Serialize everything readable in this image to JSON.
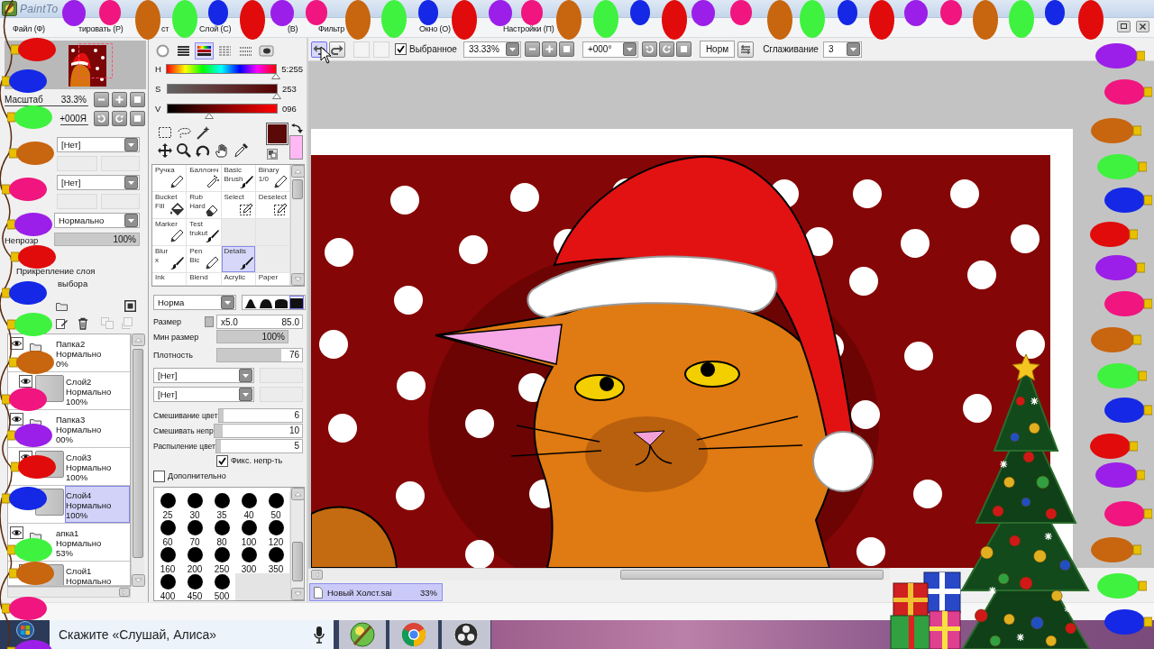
{
  "window": {
    "title": "PaintTo"
  },
  "menu": [
    {
      "label": "Файл (Ф)"
    },
    {
      "label": "тировать (Р)"
    },
    {
      "label": "ст"
    },
    {
      "label": "Слой (С)"
    },
    {
      "label": "(В)"
    },
    {
      "label": "Фильтр"
    },
    {
      "label": "Окно (О)"
    },
    {
      "label": "Настройки (П)"
    }
  ],
  "toolbar": {
    "history": [
      {
        "hovered": true
      },
      {
        "hovered": false
      }
    ],
    "selected_filter": {
      "label": "Выбранное",
      "checked": true
    },
    "zoom": "33.33%",
    "angle": "+000°",
    "flip": "Норм",
    "smoothing_label": "Сглаживание",
    "smoothing": "3"
  },
  "navigator": {
    "zoom_label": "Масштаб",
    "zoom": "33.3%",
    "angle": "+000Я"
  },
  "layer_props": {
    "texture": "[Нет]",
    "effect": "[Нет]",
    "blend": "Нормально",
    "opacity": {
      "label": "Непрозр",
      "value": "100%",
      "level": 1
    },
    "clipping": "Прикрепление слоя",
    "selection_source": "выбора"
  },
  "layers": [
    {
      "kind": "folder",
      "name": "Папка2",
      "mode": "Нормально",
      "opacity": "0%",
      "selected": false,
      "children": [
        {
          "kind": "layer",
          "name": "Слой2",
          "mode": "Нормально",
          "opacity": "100%",
          "selected": false
        }
      ]
    },
    {
      "kind": "folder",
      "name": "Папка3",
      "mode": "Нормально",
      "opacity": "00%",
      "selected": false,
      "children": [
        {
          "kind": "layer",
          "name": "Слой3",
          "mode": "Нормально",
          "opacity": "100%",
          "selected": false
        },
        {
          "kind": "layer",
          "name": "Слой4",
          "mode": "Нормально",
          "opacity": "100%",
          "selected": true
        }
      ]
    },
    {
      "kind": "folder",
      "name": "апка1",
      "mode": "Нормально",
      "opacity": "53%",
      "selected": false,
      "children": [
        {
          "kind": "layer",
          "name": "Слой1",
          "mode": "Нормально",
          "selected": false
        }
      ]
    }
  ],
  "colors": {
    "modes": [
      {
        "selected": false
      },
      {
        "selected": false
      },
      {
        "selected": true
      },
      {
        "selected": false
      },
      {
        "selected": false
      },
      {
        "selected": false
      }
    ],
    "sliders": [
      {
        "label": "H",
        "value": "5:255",
        "level": 0.99
      },
      {
        "label": "S",
        "value": "253",
        "level": 0.99
      },
      {
        "label": "V",
        "value": "096",
        "level": 0.38
      }
    ],
    "swatches": [
      {
        "color": "#5a0808"
      },
      {
        "color": "#ffb8f4"
      }
    ]
  },
  "tools": {
    "rows": [
      [
        {
          "label": "Ручка",
          "selected": false
        },
        {
          "label": "Баллонч",
          "selected": false
        },
        {
          "label": "Basic Brush",
          "selected": false
        },
        {
          "label": "Binary 1/0",
          "selected": false
        }
      ],
      [
        {
          "label": "Bucket Fill",
          "selected": false
        },
        {
          "label": "Rub Hard",
          "selected": false
        },
        {
          "label": "Select",
          "selected": false
        },
        {
          "label": "Deselect",
          "selected": false
        }
      ],
      [
        {
          "label": "Marker",
          "selected": false
        },
        {
          "label": "Test trukut",
          "selected": false
        }
      ],
      [
        {
          "label": "Blur x",
          "selected": false
        },
        {
          "label": "Pen Bic",
          "selected": false
        },
        {
          "label": "Details",
          "selected": true
        }
      ],
      [
        {
          "label": "Ink",
          "selected": false
        },
        {
          "label": "Blend",
          "selected": false
        },
        {
          "label": "Acrylic",
          "selected": false
        },
        {
          "label": "Paper",
          "selected": false
        }
      ]
    ]
  },
  "brush": {
    "shape": "Норма",
    "tips": [
      {
        "selected": false
      },
      {
        "selected": false
      },
      {
        "selected": false
      },
      {
        "selected": true
      }
    ],
    "size": {
      "label": "Размер",
      "multiplier": "x5.0",
      "value": "85.0"
    },
    "min_size": {
      "label": "Мин размер",
      "value": "100%",
      "level": 1
    },
    "density": {
      "label": "Плотность",
      "value": "76",
      "level": 0.76
    },
    "textures": [
      {
        "value": "[Нет]"
      },
      {
        "value": "[Нет]"
      }
    ],
    "mixing": [
      {
        "label": "Смешивание цвет",
        "value": "6",
        "level": 0.06
      },
      {
        "label": "Смешивать непр",
        "value": "10",
        "level": 0.1
      },
      {
        "label": "Распыление цвет",
        "value": "5",
        "level": 0.05
      }
    ],
    "checks": [
      {
        "label": "Фикс. непр-ть",
        "checked": true
      },
      {
        "label": "Дополнительно",
        "checked": false
      }
    ]
  },
  "brush_sizes": [
    "25",
    "30",
    "35",
    "40",
    "50",
    "60",
    "70",
    "80",
    "100",
    "120",
    "160",
    "200",
    "250",
    "300",
    "350",
    "400",
    "450",
    "500"
  ],
  "documents": [
    {
      "name": "Новый Холст.sai",
      "zoom": "33%",
      "selected": true
    }
  ],
  "taskbar": {
    "search": {
      "placeholder": "Скажите «Слушай, Алиса»"
    }
  },
  "lights": {
    "top": [
      {
        "color": "#9b1fe8"
      },
      {
        "color": "#f0157f"
      },
      {
        "color": "#c8650f"
      },
      {
        "color": "#3ff23f"
      },
      {
        "color": "#1428e6"
      },
      {
        "color": "#e10b0b"
      },
      {
        "color": "#9b1fe8"
      },
      {
        "color": "#f0157f"
      },
      {
        "color": "#c8650f"
      },
      {
        "color": "#3ff23f"
      },
      {
        "color": "#1428e6"
      },
      {
        "color": "#e10b0b"
      },
      {
        "color": "#9b1fe8"
      },
      {
        "color": "#f0157f"
      },
      {
        "color": "#c8650f"
      },
      {
        "color": "#3ff23f"
      },
      {
        "color": "#1428e6"
      },
      {
        "color": "#e10b0b"
      },
      {
        "color": "#9b1fe8"
      },
      {
        "color": "#f0157f"
      },
      {
        "color": "#c8650f"
      },
      {
        "color": "#3ff23f"
      },
      {
        "color": "#1428e6"
      },
      {
        "color": "#e10b0b"
      },
      {
        "color": "#9b1fe8"
      },
      {
        "color": "#f0157f"
      },
      {
        "color": "#c8650f"
      },
      {
        "color": "#3ff23f"
      },
      {
        "color": "#1428e6"
      },
      {
        "color": "#e10b0b"
      }
    ],
    "left": [
      {
        "color": "#e10b0b"
      },
      {
        "color": "#1428e6"
      },
      {
        "color": "#3ff23f"
      },
      {
        "color": "#c8650f"
      },
      {
        "color": "#f0157f"
      },
      {
        "color": "#9b1fe8"
      },
      {
        "color": "#e10b0b"
      },
      {
        "color": "#1428e6"
      },
      {
        "color": "#3ff23f"
      },
      {
        "color": "#c8650f"
      },
      {
        "color": "#f0157f"
      },
      {
        "color": "#9b1fe8"
      },
      {
        "color": "#e10b0b"
      },
      {
        "color": "#1428e6"
      },
      {
        "color": "#3ff23f"
      },
      {
        "color": "#c8650f"
      },
      {
        "color": "#f0157f"
      },
      {
        "color": "#9b1fe8"
      }
    ],
    "right": [
      {
        "color": "#9b1fe8"
      },
      {
        "color": "#f0157f"
      },
      {
        "color": "#c8650f"
      },
      {
        "color": "#3ff23f"
      },
      {
        "color": "#1428e6"
      },
      {
        "color": "#e10b0b"
      },
      {
        "color": "#9b1fe8"
      },
      {
        "color": "#f0157f"
      },
      {
        "color": "#c8650f"
      },
      {
        "color": "#3ff23f"
      },
      {
        "color": "#1428e6"
      },
      {
        "color": "#e10b0b"
      },
      {
        "color": "#9b1fe8"
      },
      {
        "color": "#f0157f"
      },
      {
        "color": "#c8650f"
      },
      {
        "color": "#3ff23f"
      },
      {
        "color": "#1428e6"
      }
    ]
  }
}
